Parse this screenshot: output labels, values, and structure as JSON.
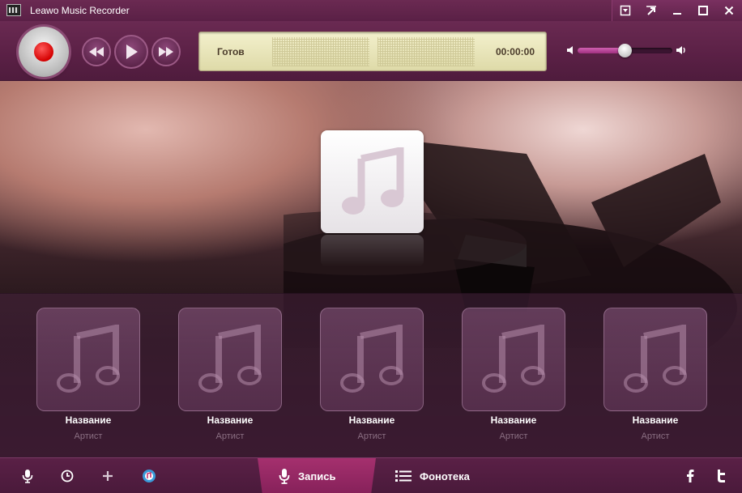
{
  "window": {
    "title": "Leawo Music Recorder"
  },
  "window_controls": [
    "menu-icon",
    "mini-mode-icon",
    "minimize-icon",
    "maximize-icon",
    "close-icon"
  ],
  "status": {
    "text": "Готов",
    "time": "00:00:00"
  },
  "volume": {
    "level": 0.5
  },
  "tracks": [
    {
      "title": "Название",
      "artist": "Артист"
    },
    {
      "title": "Название",
      "artist": "Артист"
    },
    {
      "title": "Название",
      "artist": "Артист"
    },
    {
      "title": "Название",
      "artist": "Артист"
    },
    {
      "title": "Название",
      "artist": "Артист"
    }
  ],
  "tabs": {
    "record": "Запись",
    "library": "Фонотека"
  },
  "colors": {
    "accent": "#a5306e",
    "frame": "#5a2046",
    "lcd": "#eae6ba",
    "record": "#d40000"
  }
}
